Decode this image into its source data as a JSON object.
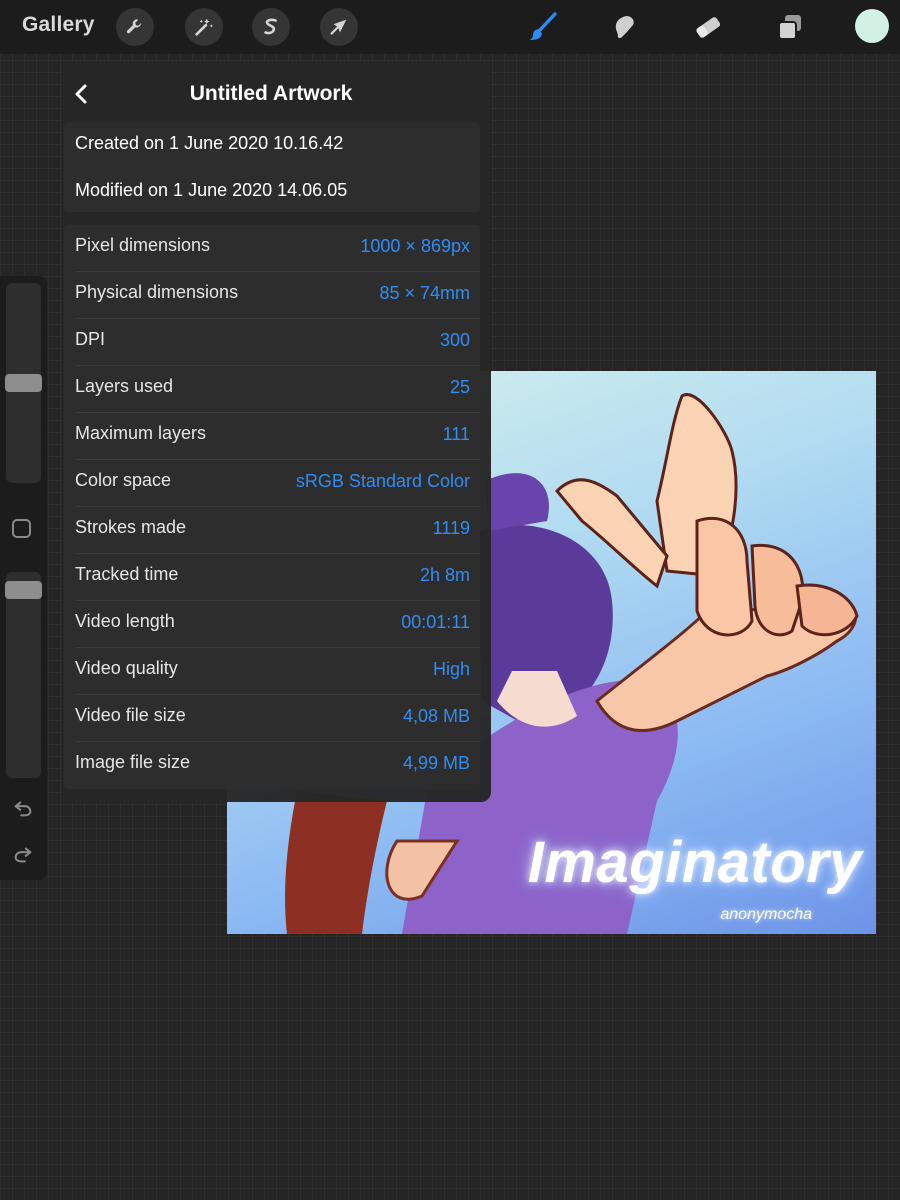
{
  "toolbar": {
    "gallery_label": "Gallery",
    "left_tools": [
      "wrench-icon",
      "magic-wand-icon",
      "selection-s-icon",
      "transform-arrow-icon"
    ],
    "right_tools": [
      "brush-icon",
      "smudge-icon",
      "eraser-icon",
      "layers-icon"
    ],
    "active_tool": "brush-icon",
    "accent_color": "#2a8cf7",
    "current_color": "#d2f1e4"
  },
  "panel": {
    "title": "Untitled Artwork",
    "created": "Created on 1 June 2020 10.16.42",
    "modified": "Modified on 1 June 2020 14.06.05",
    "rows": [
      {
        "label": "Pixel dimensions",
        "value": "1000 × 869px"
      },
      {
        "label": "Physical dimensions",
        "value": "85 × 74mm"
      },
      {
        "label": "DPI",
        "value": "300"
      },
      {
        "label": "Layers used",
        "value": "25"
      },
      {
        "label": "Maximum layers",
        "value": "111"
      },
      {
        "label": "Color space",
        "value": "sRGB Standard Color"
      },
      {
        "label": "Strokes made",
        "value": "1119"
      },
      {
        "label": "Tracked time",
        "value": "2h 8m"
      },
      {
        "label": "Video length",
        "value": "00:01:11"
      },
      {
        "label": "Video quality",
        "value": "High"
      },
      {
        "label": "Video file size",
        "value": "4,08 MB"
      },
      {
        "label": "Image file size",
        "value": "4,99 MB"
      }
    ]
  },
  "sidebar": {
    "brush_size_level": 0.5,
    "opacity_level": 0.95
  },
  "artwork": {
    "caption": "Imaginatory",
    "signature": "anonymocha"
  }
}
